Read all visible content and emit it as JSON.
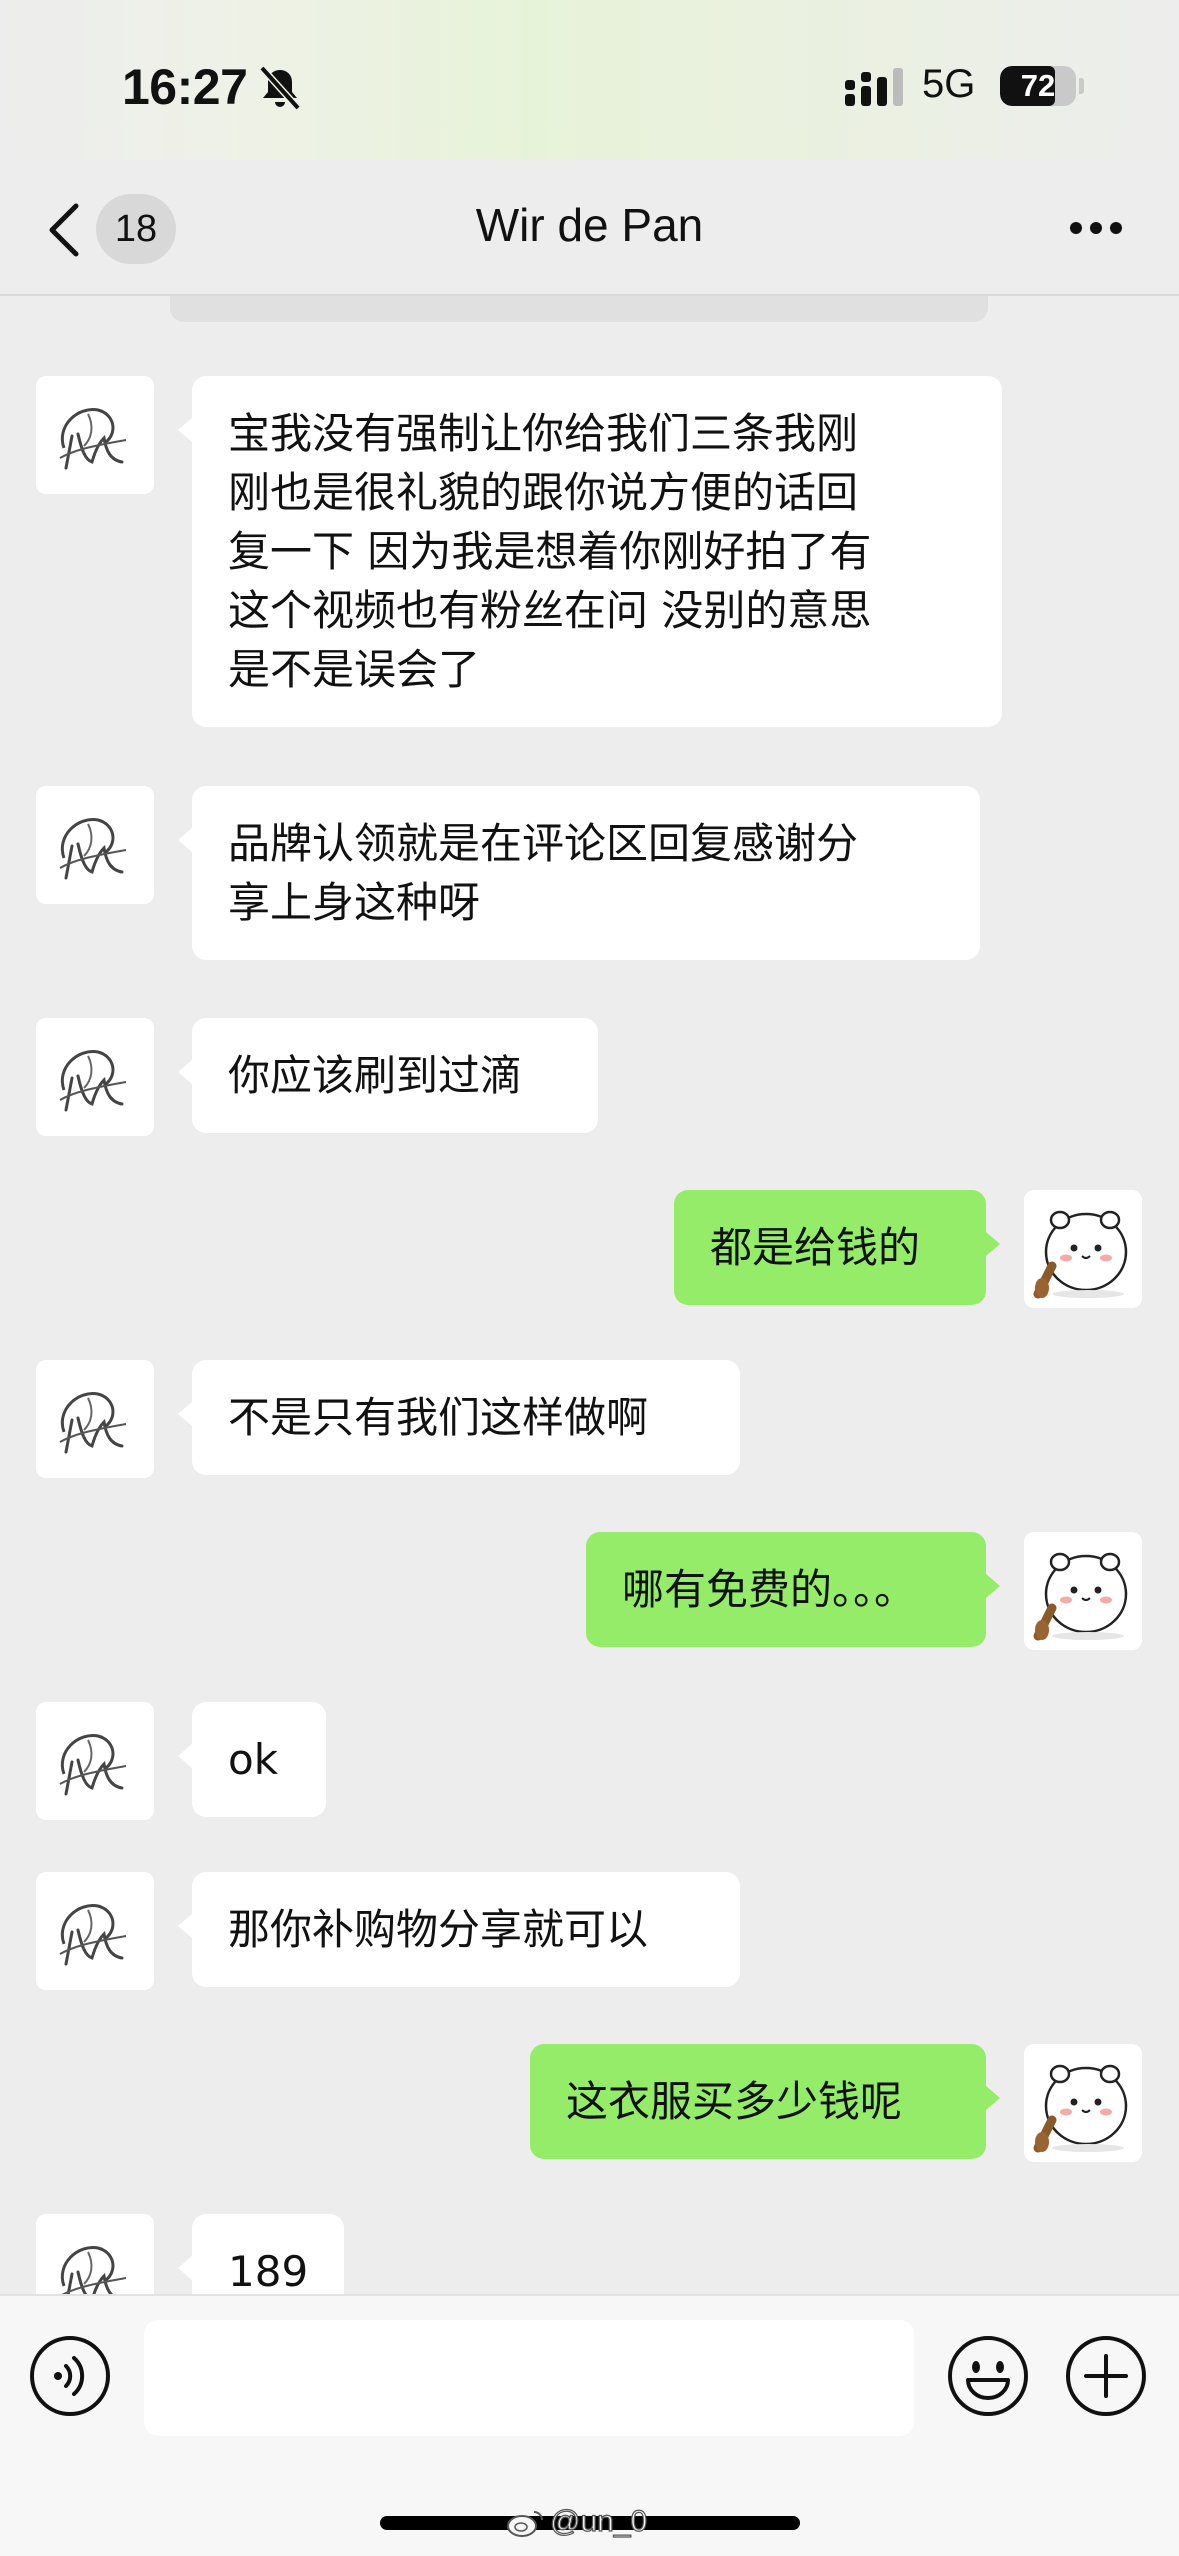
{
  "status_bar": {
    "time": "16:27",
    "network": "5G",
    "battery_level": 72,
    "battery_label": "72",
    "icons": [
      "bell-slash-icon",
      "signal-bars-icon"
    ]
  },
  "nav": {
    "back_icon": "chevron-left-icon",
    "unread_count": "18",
    "title": "Wir de Pan",
    "more_icon": "ellipsis-icon"
  },
  "messages": [
    {
      "side": "left",
      "text": "宝我没有强制让你给我们三条我刚\n刚也是很礼貌的跟你说方便的话回\n复一下 因为我是想着你刚好拍了有\n这个视频也有粉丝在问 没别的意思\n是不是误会了"
    },
    {
      "side": "left",
      "text": "品牌认领就是在评论区回复感谢分\n享上身这种呀"
    },
    {
      "side": "left",
      "text": "你应该刷到过滴"
    },
    {
      "side": "right",
      "text": "都是给钱的"
    },
    {
      "side": "left",
      "text": "不是只有我们这样做啊"
    },
    {
      "side": "right",
      "text": "哪有免费的。。。"
    },
    {
      "side": "left",
      "text": "ok"
    },
    {
      "side": "left",
      "text": "那你补购物分享就可以"
    },
    {
      "side": "right",
      "text": "这衣服买多少钱呢"
    },
    {
      "side": "left",
      "text": "189"
    }
  ],
  "avatars": {
    "contact": "signature-logo-avatar",
    "self": "white-cartoon-hamster-avatar"
  },
  "input_bar": {
    "voice_icon": "voice-wave-icon",
    "input_value": "",
    "emoji_icon": "smiley-face-icon",
    "plus_icon": "plus-circle-icon"
  },
  "watermark": "@un_0",
  "colors": {
    "background": "#ededed",
    "outgoing_bubble": "#95ec69",
    "incoming_bubble": "#ffffff"
  }
}
